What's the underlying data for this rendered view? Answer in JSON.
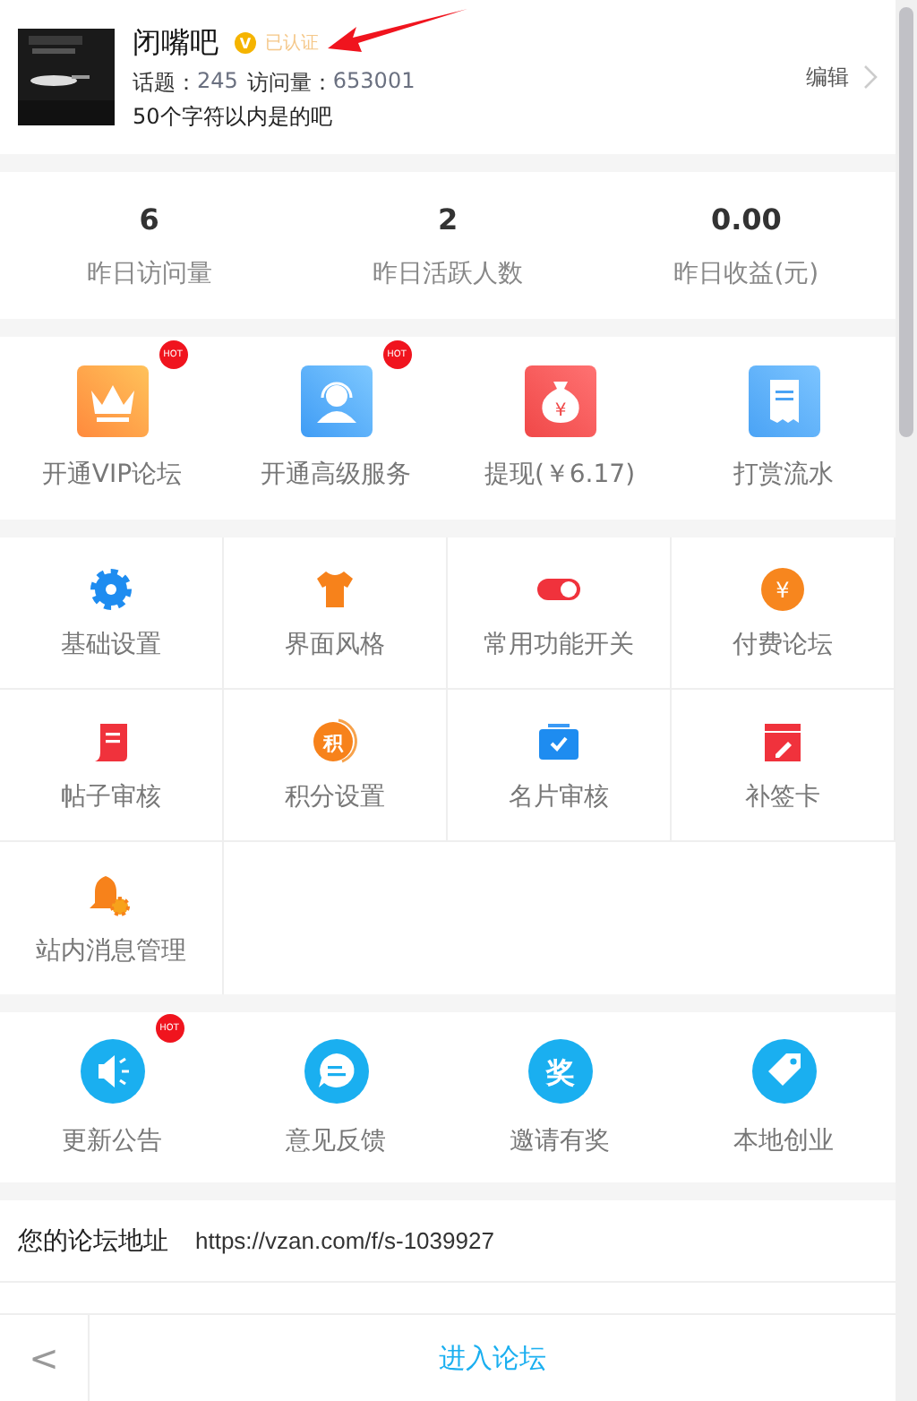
{
  "profile": {
    "name": "闭嘴吧",
    "verified": {
      "mark": "V",
      "label": "已认证"
    },
    "counts": [
      {
        "label": "话题：",
        "value": "245"
      },
      {
        "label": "访问量：",
        "value": "653001"
      }
    ],
    "description": "50个字符以内是的吧",
    "edit": "编辑"
  },
  "stats": [
    {
      "value": "6",
      "label": "昨日访问量"
    },
    {
      "value": "2",
      "label": "昨日活跃人数"
    },
    {
      "value": "0.00",
      "label": "昨日收益(元)"
    }
  ],
  "services": [
    {
      "label": "开通VIP论坛",
      "badge": "HOT"
    },
    {
      "label": "开通高级服务",
      "badge": "HOT"
    },
    {
      "label": "提现(￥6.17)",
      "glyph": "¥"
    },
    {
      "label": "打赏流水"
    }
  ],
  "settings": [
    {
      "label": "基础设置"
    },
    {
      "label": "界面风格"
    },
    {
      "label": "常用功能开关"
    },
    {
      "label": "付费论坛",
      "glyph": "¥"
    },
    {
      "label": "帖子审核"
    },
    {
      "label": "积分设置",
      "glyph": "积"
    },
    {
      "label": "名片审核"
    },
    {
      "label": "补签卡"
    },
    {
      "label": "站内消息管理"
    }
  ],
  "extras": [
    {
      "label": "更新公告",
      "badge": "HOT"
    },
    {
      "label": "意见反馈"
    },
    {
      "label": "邀请有奖",
      "glyph": "奖"
    },
    {
      "label": "本地创业"
    }
  ],
  "address": {
    "label": "您的论坛地址",
    "url": "https://vzan.com/f/s-1039927"
  },
  "bottom_bar": {
    "back": "<",
    "enter": "进入论坛"
  }
}
